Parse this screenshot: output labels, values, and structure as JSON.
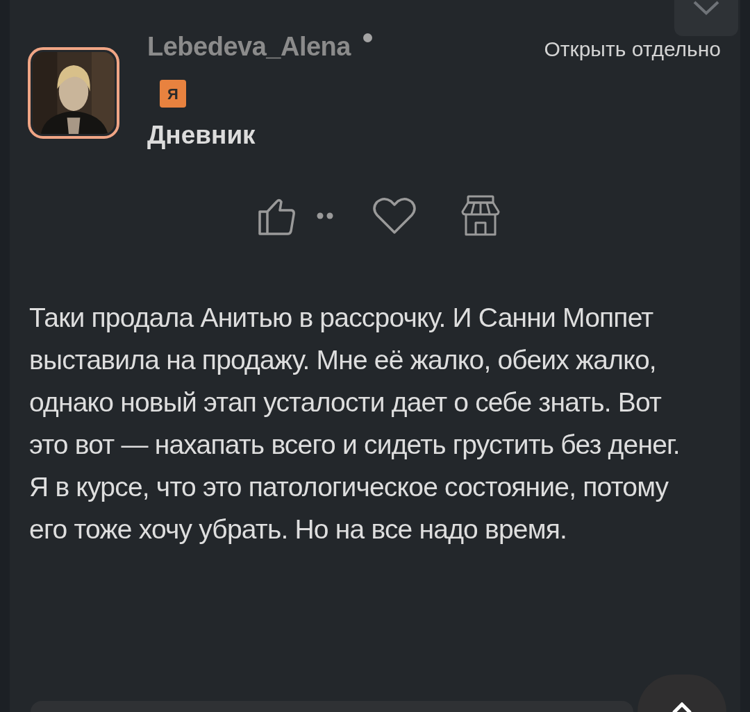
{
  "post": {
    "author": "Lebedeva_Alena",
    "online": true,
    "badge": "Я",
    "open_link": "Открыть отдельно",
    "category": "Дневник",
    "paragraphs": [
      "Таки продала Анитью в рассрочку. И Санни Моппет выставила на продажу. Мне её жалко, обеих жалко, однако новый этап усталости дает о себе знать. Вот это вот — нахапать всего и сидеть грустить без денег.",
      "Я в курсе, что это патологическое состояние, потому его тоже хочу убрать. Но на все надо время."
    ]
  }
}
